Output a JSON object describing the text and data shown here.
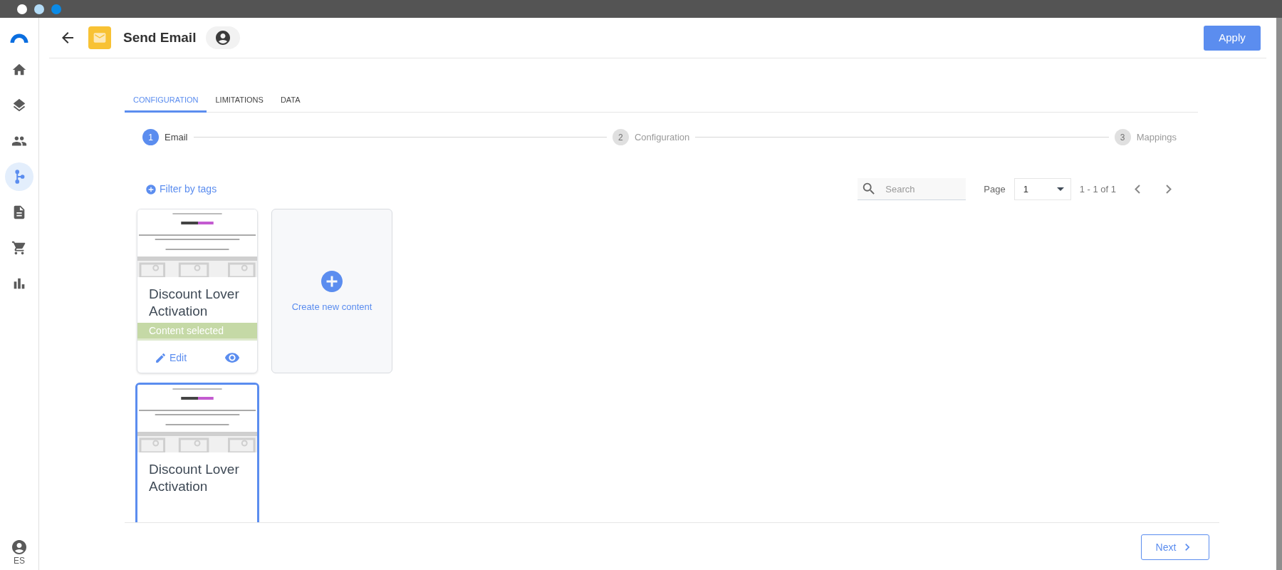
{
  "sidebar": {
    "items": [
      {
        "kind": "home",
        "selected": false
      },
      {
        "kind": "layers",
        "selected": false
      },
      {
        "kind": "people",
        "selected": false
      },
      {
        "kind": "branch",
        "selected": true
      },
      {
        "kind": "document",
        "selected": false
      },
      {
        "kind": "cart",
        "selected": false
      },
      {
        "kind": "chart",
        "selected": false
      }
    ],
    "user": "ES"
  },
  "header": {
    "title": "Send Email",
    "apply": "Apply"
  },
  "tabs": [
    {
      "label": "CONFIGURATION",
      "selected": true
    },
    {
      "label": "LIMITATIONS",
      "selected": false
    },
    {
      "label": "DATA",
      "selected": false
    }
  ],
  "steps": [
    {
      "number": "1",
      "label": "Email",
      "active": true
    },
    {
      "number": "2",
      "label": "Configuration",
      "active": false
    },
    {
      "number": "3",
      "label": "Mappings",
      "active": false
    }
  ],
  "toolbar": {
    "filter": "Filter by tags",
    "search_placeholder": "Search",
    "page_label": "Page",
    "page_value": "1",
    "range": "1 - 1 of 1"
  },
  "cards": [
    {
      "kind": "content",
      "title": "Discount Lover Activation",
      "selected": false,
      "status": "Content selected",
      "edit": "Edit"
    },
    {
      "kind": "create",
      "label": "Create new content"
    },
    {
      "kind": "content",
      "title": "Discount Lover Activation",
      "selected": true
    }
  ],
  "footer": {
    "next": "Next"
  }
}
